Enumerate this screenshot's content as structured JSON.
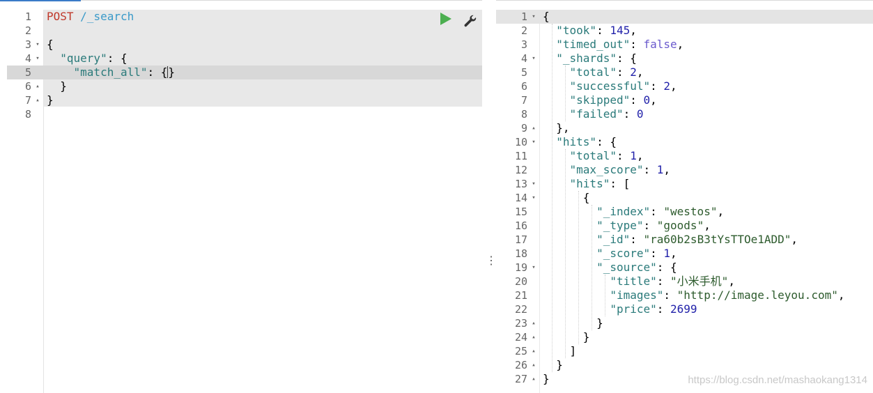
{
  "request": {
    "method": "POST",
    "path": "/_search",
    "lines": [
      {
        "n": "1",
        "fold": ""
      },
      {
        "n": "2",
        "fold": ""
      },
      {
        "n": "3",
        "fold": "▾"
      },
      {
        "n": "4",
        "fold": "▾"
      },
      {
        "n": "5",
        "fold": ""
      },
      {
        "n": "6",
        "fold": "▴"
      },
      {
        "n": "7",
        "fold": "▴"
      },
      {
        "n": "8",
        "fold": ""
      }
    ],
    "tokens": {
      "open": "{",
      "query_key": "\"query\"",
      "match_all_key": "\"match_all\"",
      "empty_obj_open": "{",
      "empty_obj_close": "}",
      "close_inner": "}",
      "close": "}"
    }
  },
  "toolbar": {
    "run_icon": "play-icon",
    "settings_icon": "wrench-icon"
  },
  "response": {
    "lines": [
      {
        "n": "1",
        "fold": "▾"
      },
      {
        "n": "2",
        "fold": ""
      },
      {
        "n": "3",
        "fold": ""
      },
      {
        "n": "4",
        "fold": "▾"
      },
      {
        "n": "5",
        "fold": ""
      },
      {
        "n": "6",
        "fold": ""
      },
      {
        "n": "7",
        "fold": ""
      },
      {
        "n": "8",
        "fold": ""
      },
      {
        "n": "9",
        "fold": "▴"
      },
      {
        "n": "10",
        "fold": "▾"
      },
      {
        "n": "11",
        "fold": ""
      },
      {
        "n": "12",
        "fold": ""
      },
      {
        "n": "13",
        "fold": "▾"
      },
      {
        "n": "14",
        "fold": "▾"
      },
      {
        "n": "15",
        "fold": ""
      },
      {
        "n": "16",
        "fold": ""
      },
      {
        "n": "17",
        "fold": ""
      },
      {
        "n": "18",
        "fold": ""
      },
      {
        "n": "19",
        "fold": "▾"
      },
      {
        "n": "20",
        "fold": ""
      },
      {
        "n": "21",
        "fold": ""
      },
      {
        "n": "22",
        "fold": ""
      },
      {
        "n": "23",
        "fold": "▴"
      },
      {
        "n": "24",
        "fold": "▴"
      },
      {
        "n": "25",
        "fold": "▴"
      },
      {
        "n": "26",
        "fold": "▴"
      },
      {
        "n": "27",
        "fold": "▴"
      }
    ],
    "took": "145",
    "timed_out": "false",
    "shards_total": "2",
    "shards_successful": "2",
    "shards_skipped": "0",
    "shards_failed": "0",
    "hits_total": "1",
    "max_score": "1",
    "index": "\"westos\"",
    "type": "\"goods\"",
    "id": "\"ra60b2sB3tYsTTOe1ADD\"",
    "score": "1",
    "title": "\"小米手机\"",
    "images": "\"http://image.leyou.com\"",
    "price": "2699"
  },
  "splitter_glyph": "⋮",
  "watermark": "https://blog.csdn.net/mashaokang1314"
}
